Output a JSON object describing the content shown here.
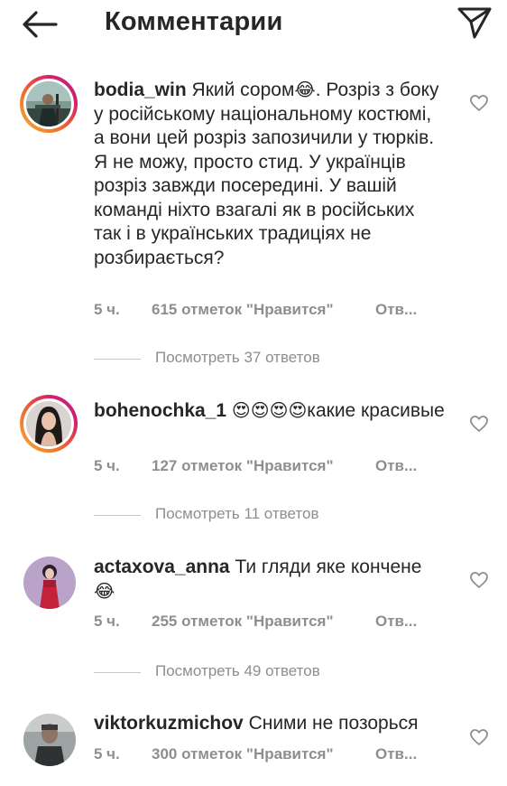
{
  "header": {
    "title": "Комментарии",
    "back_icon": "arrow-left-icon",
    "send_icon": "paper-plane-icon"
  },
  "comments": [
    {
      "username": "bodia_win",
      "text_before_emoji": "Який сором",
      "emoji": "😂",
      "text_after_emoji": ". Розріз з боку у російському національному костюмі, а вони цей розріз запозичили у тюрків. Я не можу, просто стид. У українців розріз завжди посередині. У вашій команді ніхто взагалі як в російських так і в українських традиціях не розбирається?",
      "time": "5 ч.",
      "likes": "615 отметок \"Нравится\"",
      "reply": "Отв...",
      "view_replies": "Посмотреть 37 ответов",
      "has_story_ring": true
    },
    {
      "username": "bohenochka_1",
      "emoji": "😍😍😍😍",
      "text_after_emoji": "какие красивые",
      "time": "5 ч.",
      "likes": "127 отметок \"Нравится\"",
      "reply": "Отв...",
      "view_replies": "Посмотреть 11 ответов",
      "has_story_ring": true
    },
    {
      "username": "actaxova_anna",
      "text_before_emoji": "Ти гляди яке кончене",
      "emoji": "😂",
      "time": "5 ч.",
      "likes": "255 отметок \"Нравится\"",
      "reply": "Отв...",
      "view_replies": "Посмотреть 49 ответов",
      "has_story_ring": false
    },
    {
      "username": "viktorkuzmichov",
      "text_before_emoji": "Сними не позорься",
      "time": "5 ч.",
      "likes": "300 отметок \"Нравится\"",
      "reply": "Отв...",
      "has_story_ring": false
    }
  ],
  "colors": {
    "text": "#262626",
    "secondary": "#8e8e8e",
    "ring_gradient": [
      "#f9b233",
      "#ef6a2e",
      "#d6206c",
      "#b31f8c"
    ]
  },
  "icons": {
    "like": "heart-outline-icon"
  }
}
